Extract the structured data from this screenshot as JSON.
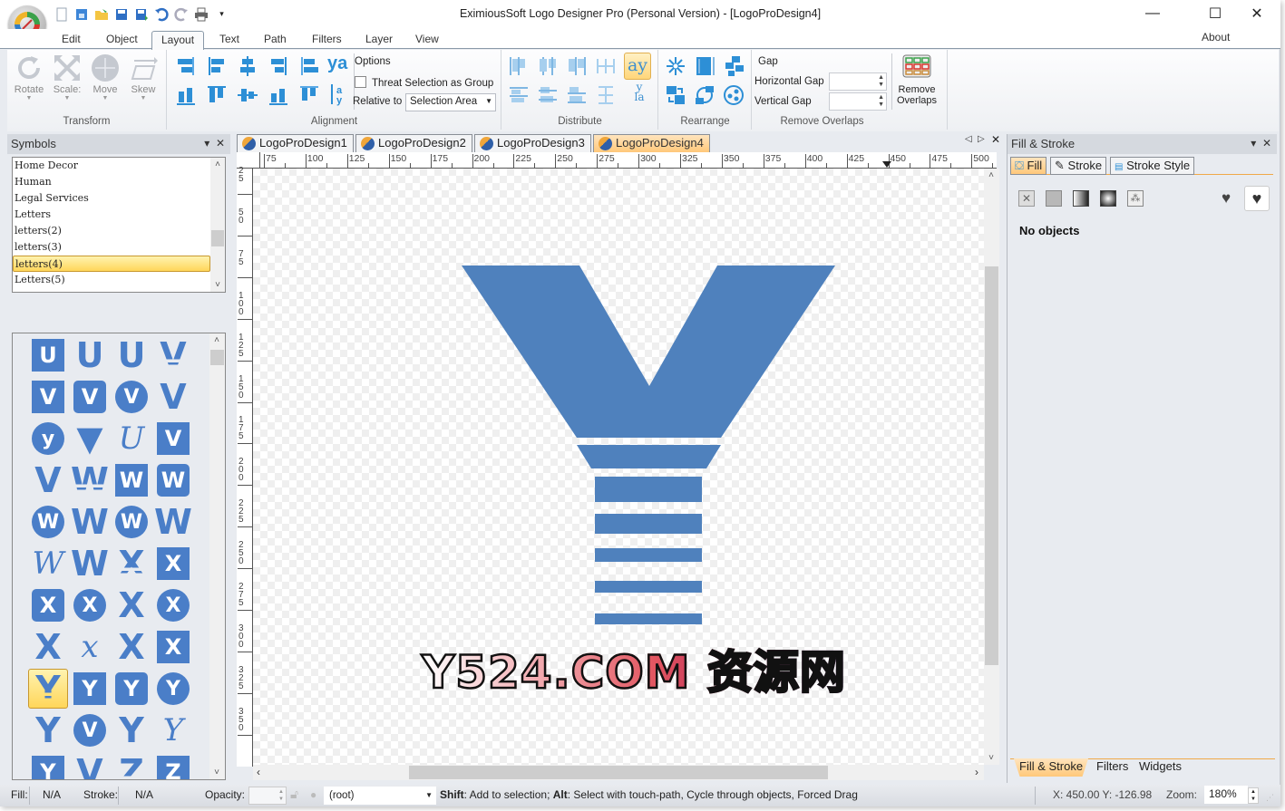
{
  "window": {
    "title": "EximiousSoft Logo Designer Pro (Personal Version) - [LogoProDesign4]",
    "controls": {
      "minimize": "—",
      "maximize": "☐",
      "close": "✕"
    }
  },
  "quick_access": [
    "new-icon",
    "open-template-icon",
    "open-folder-icon",
    "save-icon",
    "save-as-icon",
    "undo-icon",
    "redo-icon",
    "print-icon",
    "customize-dropdown-icon"
  ],
  "ribbon_tabs": [
    {
      "label": "Edit"
    },
    {
      "label": "Object"
    },
    {
      "label": "Layout",
      "active": true
    },
    {
      "label": "Text"
    },
    {
      "label": "Path"
    },
    {
      "label": "Filters"
    },
    {
      "label": "Layer"
    },
    {
      "label": "View"
    }
  ],
  "about_label": "About",
  "ribbon": {
    "transform": {
      "label": "Transform",
      "buttons": [
        {
          "label": "Rotate"
        },
        {
          "label": "Scale:"
        },
        {
          "label": "Move"
        },
        {
          "label": "Skew"
        }
      ]
    },
    "alignment": {
      "label": "Alignment",
      "options_label": "Options",
      "threat_selection_label": "Threat Selection as Group",
      "threat_selection_checked": false,
      "relative_to_label": "Relative to",
      "relative_to_value": "Selection Area"
    },
    "distribute": {
      "label": "Distribute"
    },
    "rearrange": {
      "label": "Rearrange"
    },
    "remove_overlaps": {
      "label": "Remove Overlaps",
      "gap_label": "Gap",
      "horizontal_gap_label": "Horizontal Gap",
      "horizontal_gap_value": "",
      "vertical_gap_label": "Vertical Gap",
      "vertical_gap_value": "",
      "button_label_1": "Remove",
      "button_label_2": "Overlaps"
    }
  },
  "symbols_panel": {
    "title": "Symbols",
    "categories": [
      {
        "label": "Home Decor"
      },
      {
        "label": "Human"
      },
      {
        "label": "Legal Services"
      },
      {
        "label": "Letters"
      },
      {
        "label": "letters(2)"
      },
      {
        "label": "letters(3)"
      },
      {
        "label": "letters(4)",
        "selected": true
      },
      {
        "label": "Letters(5)"
      }
    ],
    "nav": [
      "first-page-icon",
      "prev-page-icon",
      "next-page-icon",
      "last-page-icon"
    ],
    "symbols": [
      {
        "glyph": "U",
        "style": "square"
      },
      {
        "glyph": "U",
        "style": "jagged"
      },
      {
        "glyph": "U",
        "style": "solid"
      },
      {
        "glyph": "V",
        "style": "striped"
      },
      {
        "glyph": "V",
        "style": "square"
      },
      {
        "glyph": "V",
        "style": "rounded-square"
      },
      {
        "glyph": "V",
        "style": "circle"
      },
      {
        "glyph": "V",
        "style": "heart"
      },
      {
        "glyph": "y",
        "style": "circle"
      },
      {
        "glyph": "▼",
        "style": "plain"
      },
      {
        "glyph": "U",
        "style": "script"
      },
      {
        "glyph": "V",
        "style": "square"
      },
      {
        "glyph": "V",
        "style": "jagged"
      },
      {
        "glyph": "W",
        "style": "striped"
      },
      {
        "glyph": "W",
        "style": "square"
      },
      {
        "glyph": "W",
        "style": "rounded-square"
      },
      {
        "glyph": "W",
        "style": "circle"
      },
      {
        "glyph": "W",
        "style": "plain"
      },
      {
        "glyph": "W",
        "style": "circle"
      },
      {
        "glyph": "W",
        "style": "banner"
      },
      {
        "glyph": "W",
        "style": "script"
      },
      {
        "glyph": "W",
        "style": "jagged"
      },
      {
        "glyph": "X",
        "style": "striped"
      },
      {
        "glyph": "X",
        "style": "square"
      },
      {
        "glyph": "X",
        "style": "rounded-square"
      },
      {
        "glyph": "X",
        "style": "circle"
      },
      {
        "glyph": "X",
        "style": "plain"
      },
      {
        "glyph": "X",
        "style": "circle"
      },
      {
        "glyph": "X",
        "style": "hourglass"
      },
      {
        "glyph": "x",
        "style": "script"
      },
      {
        "glyph": "X",
        "style": "jagged"
      },
      {
        "glyph": "X",
        "style": "square"
      },
      {
        "glyph": "Y",
        "style": "striped",
        "selected": true
      },
      {
        "glyph": "Y",
        "style": "square"
      },
      {
        "glyph": "Y",
        "style": "rounded-square"
      },
      {
        "glyph": "Y",
        "style": "circle"
      },
      {
        "glyph": "Y",
        "style": "plain"
      },
      {
        "glyph": "V",
        "style": "circle"
      },
      {
        "glyph": "Y",
        "style": "solid"
      },
      {
        "glyph": "Y",
        "style": "script"
      },
      {
        "glyph": "Y",
        "style": "square"
      },
      {
        "glyph": "V",
        "style": "jagged"
      },
      {
        "glyph": "Z",
        "style": "striped"
      },
      {
        "glyph": "Z",
        "style": "square"
      }
    ]
  },
  "documents": {
    "tabs": [
      {
        "label": "LogoProDesign1"
      },
      {
        "label": "LogoProDesign2"
      },
      {
        "label": "LogoProDesign3"
      },
      {
        "label": "LogoProDesign4",
        "active": true
      }
    ],
    "ruler_h": [
      "75",
      "100",
      "125",
      "150",
      "175",
      "200",
      "225",
      "250",
      "275",
      "300",
      "325",
      "350",
      "375",
      "400",
      "425",
      "450",
      "475",
      "500"
    ],
    "ruler_v": [
      "25",
      "50",
      "75",
      "100",
      "125",
      "150",
      "175",
      "200",
      "225",
      "250",
      "275",
      "300",
      "325",
      "350"
    ]
  },
  "canvas": {
    "logo_color": "#4f81bd",
    "watermark": "Y524.COM 资源网"
  },
  "fill_stroke_panel": {
    "title": "Fill & Stroke",
    "tabs": [
      {
        "label": "Fill",
        "active": true
      },
      {
        "label": "Stroke"
      },
      {
        "label": "Stroke Style"
      }
    ],
    "fill_modes": [
      "no-paint-icon",
      "flat-color-icon",
      "linear-gradient-icon",
      "radial-gradient-icon",
      "pattern-icon"
    ],
    "fill_rules": [
      "evenodd-rule-icon",
      "nonzero-rule-icon"
    ],
    "message": "No objects",
    "bottom_tabs": [
      {
        "label": "Fill & Stroke",
        "active": true
      },
      {
        "label": "Filters"
      },
      {
        "label": "Widgets"
      }
    ]
  },
  "statusbar": {
    "fill_label": "Fill:",
    "fill_value": "N/A",
    "stroke_label": "Stroke:",
    "stroke_value": "N/A",
    "opacity_label": "Opacity:",
    "opacity_value": "",
    "layer_value": "(root)",
    "hint_shift": "Shift",
    "hint_1": ": Add to selection; ",
    "hint_alt": "Alt",
    "hint_2": ": Select with touch-path, Cycle through objects, Forced Drag",
    "coords": "X:  450.00 Y: -126.98",
    "zoom_label": "Zoom:",
    "zoom_value": "180%"
  }
}
